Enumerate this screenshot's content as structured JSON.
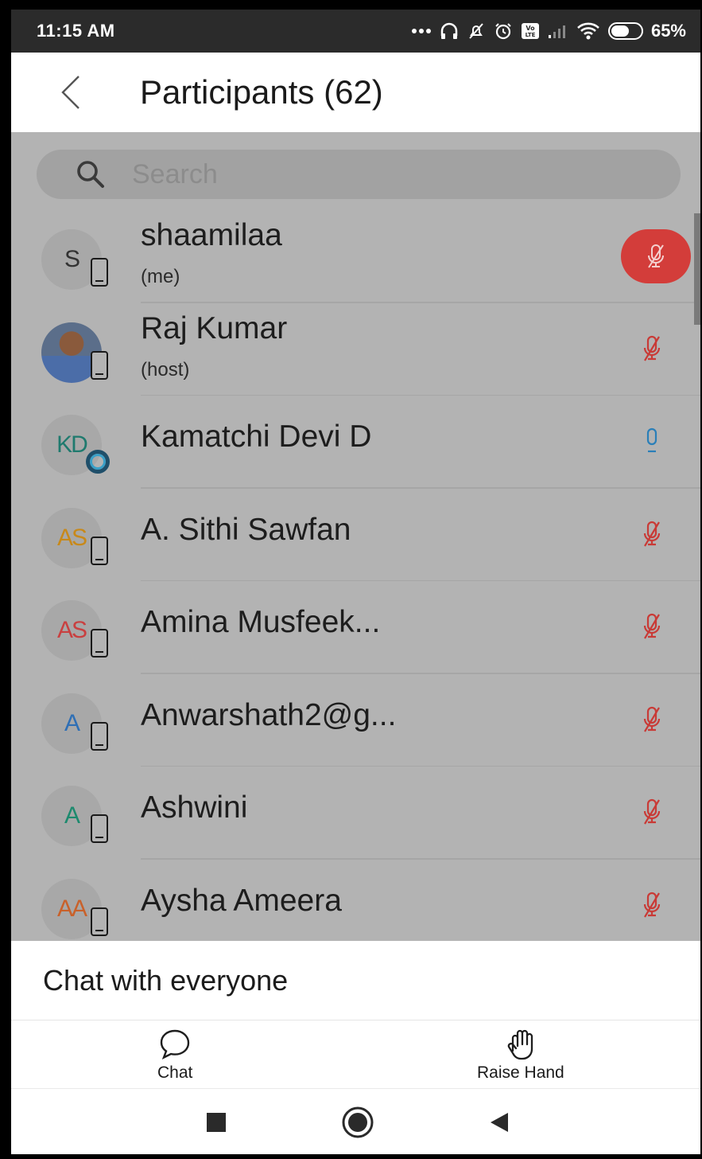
{
  "status_bar": {
    "time": "11:15 AM",
    "battery_text": "65%",
    "battery_level": 0.65,
    "icons": [
      "more-dots-icon",
      "headphones-icon",
      "mute-notifications-icon",
      "alarm-icon",
      "volte-icon",
      "signal-icon",
      "wifi-icon",
      "battery-icon"
    ]
  },
  "header": {
    "title": "Participants (62)",
    "back_icon": "back-chevron-icon"
  },
  "search": {
    "placeholder": "Search"
  },
  "participants": [
    {
      "initials": "S",
      "initials_color": "#333333",
      "name": "shaamilaa",
      "role": "(me)",
      "badge": "device",
      "mic": "muted-self"
    },
    {
      "initials": "",
      "initials_color": "#333333",
      "name": "Raj Kumar",
      "role": "(host)",
      "badge": "device",
      "mic": "muted",
      "photo": true
    },
    {
      "initials": "KD",
      "initials_color": "#1f7a6e",
      "name": "Kamatchi Devi D",
      "role": "",
      "badge": "link",
      "mic": "unmuted"
    },
    {
      "initials": "AS",
      "initials_color": "#c8891a",
      "name": "A. Sithi Sawfan",
      "role": "",
      "badge": "device",
      "mic": "muted"
    },
    {
      "initials": "AS",
      "initials_color": "#c94040",
      "name": "Amina Musfeek...",
      "role": "",
      "badge": "device",
      "mic": "muted"
    },
    {
      "initials": "A",
      "initials_color": "#2f6fb5",
      "name": "Anwarshath2@g...",
      "role": "",
      "badge": "device",
      "mic": "muted"
    },
    {
      "initials": "A",
      "initials_color": "#1d8a6e",
      "name": "Ashwini",
      "role": "",
      "badge": "device",
      "mic": "muted"
    },
    {
      "initials": "AA",
      "initials_color": "#c9612a",
      "name": "Aysha Ameera",
      "role": "",
      "badge": "device",
      "mic": "muted"
    }
  ],
  "chat_bar": {
    "label": "Chat with everyone"
  },
  "toolbar": {
    "chat_label": "Chat",
    "raise_hand_label": "Raise Hand"
  },
  "colors": {
    "muted_mic": "#c93a36",
    "unmuted_mic": "#2a7fb8",
    "self_mic_bg": "#d33d3a",
    "overlay": "#b3b3b3"
  }
}
